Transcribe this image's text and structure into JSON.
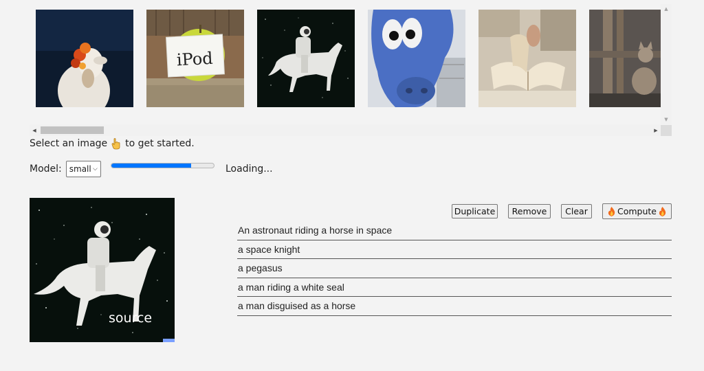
{
  "gallery": {
    "images": [
      {
        "name": "dog-with-flowers-thumb"
      },
      {
        "name": "apple-ipod-thumb",
        "text": "iPod"
      },
      {
        "name": "astronaut-horse-thumb"
      },
      {
        "name": "blue-cow-statue-thumb"
      },
      {
        "name": "open-book-thumb"
      },
      {
        "name": "cat-window-thumb"
      }
    ]
  },
  "instructions": {
    "before": "Select an image",
    "icon": "pointing-hand-icon",
    "after": "to get started."
  },
  "model": {
    "label": "Model:",
    "selected": "small",
    "progress": 0.78,
    "status": "Loading..."
  },
  "source": {
    "label": "source"
  },
  "actions": {
    "duplicate": "Duplicate",
    "remove": "Remove",
    "clear": "Clear",
    "compute": "Compute"
  },
  "prompts": [
    "An astronaut riding a horse in space",
    "a space knight",
    "a pegasus",
    "a man riding a white seal",
    "a man disguised as a horse"
  ],
  "colors": {
    "accent": "#0075ff",
    "background": "#f3f3f3"
  }
}
